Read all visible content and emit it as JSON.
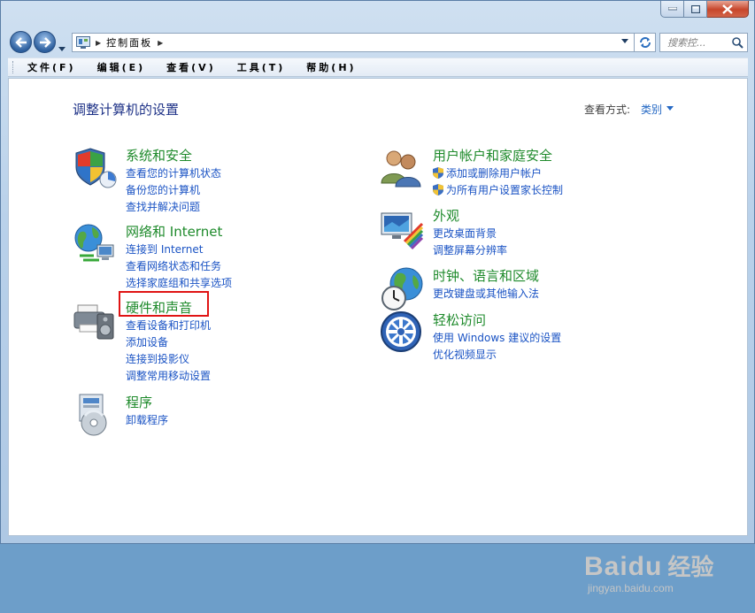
{
  "window": {
    "controls": [
      "minimize",
      "maximize",
      "close"
    ]
  },
  "nav": {
    "breadcrumb": "控制面板",
    "search_placeholder": "搜索控...",
    "icons": [
      "back-arrow-icon",
      "forward-arrow-icon",
      "chevron-down-icon",
      "control-panel-icon",
      "refresh-icon",
      "search-icon"
    ]
  },
  "menubar": {
    "items": [
      "文件(F)",
      "编辑(E)",
      "查看(V)",
      "工具(T)",
      "帮助(H)"
    ]
  },
  "content": {
    "title": "调整计算机的设置",
    "view_by_label": "查看方式:",
    "view_by_value": "类别",
    "categories": [
      {
        "title": "系统和安全",
        "icon": "shield-icon",
        "links": [
          "查看您的计算机状态",
          "备份您的计算机",
          "查找并解决问题"
        ]
      },
      {
        "title": "网络和 Internet",
        "icon": "network-globe-icon",
        "links": [
          "连接到 Internet",
          "查看网络状态和任务",
          "选择家庭组和共享选项"
        ]
      },
      {
        "title": "硬件和声音",
        "icon": "printer-icon",
        "links": [
          "查看设备和打印机",
          "添加设备",
          "连接到投影仪",
          "调整常用移动设置"
        ]
      },
      {
        "title": "程序",
        "icon": "programs-icon",
        "links": [
          "卸载程序"
        ]
      },
      {
        "title": "用户帐户和家庭安全",
        "icon": "users-icon",
        "links": [
          "添加或删除用户帐户",
          "为所有用户设置家长控制"
        ]
      },
      {
        "title": "外观",
        "icon": "appearance-icon",
        "links": [
          "更改桌面背景",
          "调整屏幕分辨率"
        ]
      },
      {
        "title": "时钟、语言和区域",
        "icon": "clock-globe-icon",
        "links": [
          "更改键盘或其他输入法"
        ]
      },
      {
        "title": "轻松访问",
        "icon": "ease-of-access-icon",
        "links": [
          "使用 Windows 建议的设置",
          "优化视频显示"
        ]
      }
    ]
  },
  "watermark": {
    "brand": "Baidu",
    "sub": "经验",
    "url": "jingyan.baidu.com"
  },
  "colors": {
    "category_title": "#1e8a2b",
    "link": "#1a53c4",
    "page_title": "#1e3287",
    "highlight": "#e01414"
  }
}
